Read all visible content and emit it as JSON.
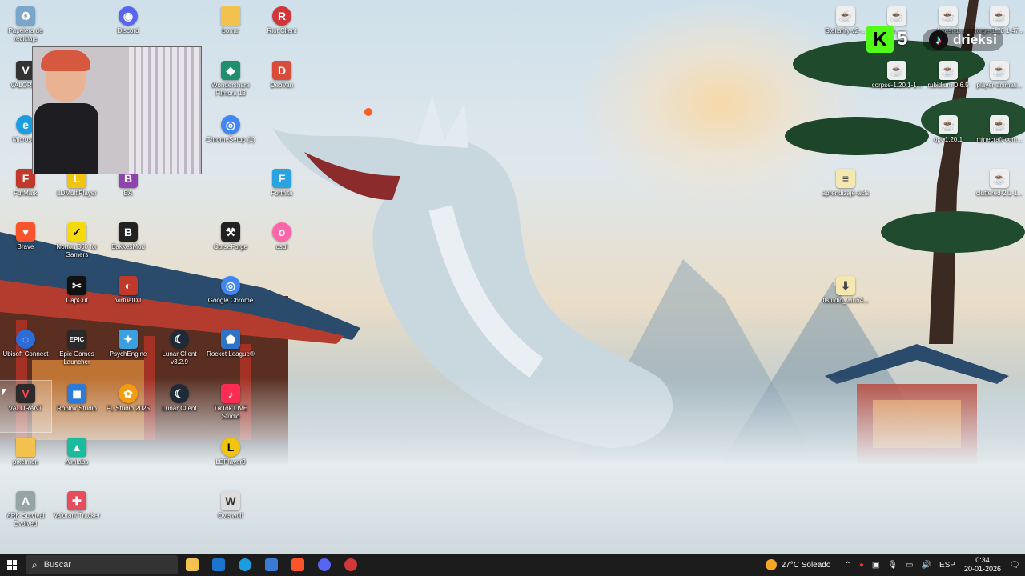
{
  "desktop_icons": [
    {
      "label": "Papelera de reciclaje",
      "icon": "recycle-bin-icon",
      "color": "#7aa6c9"
    },
    {
      "label": "Discord",
      "icon": "discord-icon",
      "color": "#5865f2"
    },
    {
      "label": "borrar",
      "icon": "folder-icon",
      "color": "#f2c14e"
    },
    {
      "label": "Riot Client",
      "icon": "riot-client-icon",
      "color": "#d13639"
    },
    {
      "label": "VALORAN",
      "icon": "valorant-icon",
      "color": "#333333"
    },
    {
      "label": "Wondershare Filmora 13",
      "icon": "filmora-icon",
      "color": "#1f8f6e"
    },
    {
      "label": "DeoVan",
      "icon": "deovan-icon",
      "color": "#d94b3a"
    },
    {
      "label": "Microsoft",
      "icon": "microsoft-edge-icon",
      "color": "#1b9de2"
    },
    {
      "label": "ChromeSetup (1)",
      "icon": "chrome-setup-icon",
      "color": "#4285f4"
    },
    {
      "label": "FurMark",
      "icon": "furmark-icon",
      "color": "#c0392b"
    },
    {
      "label": "LDMultiPlayer",
      "icon": "ldmultiplayer-icon",
      "color": "#f1c40f"
    },
    {
      "label": "BA",
      "icon": "ba-icon",
      "color": "#8e44ad"
    },
    {
      "label": "Fortnite",
      "icon": "fortnite-icon",
      "color": "#2aa3e0"
    },
    {
      "label": "Brave",
      "icon": "brave-icon",
      "color": "#fb542b"
    },
    {
      "label": "Norton 360 for Gamers",
      "icon": "norton-icon",
      "color": "#f5d90a"
    },
    {
      "label": "BakkesMod",
      "icon": "bakkesmod-icon",
      "color": "#222222"
    },
    {
      "label": "CurseForge",
      "icon": "curseforge-icon",
      "color": "#222222"
    },
    {
      "label": "osu!",
      "icon": "osu-icon",
      "color": "#ff66aa"
    },
    {
      "label": "CapCut",
      "icon": "capcut-icon",
      "color": "#111111"
    },
    {
      "label": "VirtualDJ",
      "icon": "virtualdj-icon",
      "color": "#c0392b"
    },
    {
      "label": "Google Chrome",
      "icon": "chrome-icon",
      "color": "#4285f4"
    },
    {
      "label": "Ubisoft Connect",
      "icon": "ubisoft-icon",
      "color": "#2b6cd6"
    },
    {
      "label": "Epic Games Launcher",
      "icon": "epic-games-icon",
      "color": "#2a2a2a"
    },
    {
      "label": "PsychEngine",
      "icon": "psychengine-icon",
      "color": "#3aa0e0"
    },
    {
      "label": "Lunar Client v3.2.9",
      "icon": "lunar-client-icon",
      "color": "#1e2a38"
    },
    {
      "label": "Rocket League®",
      "icon": "rocket-league-icon",
      "color": "#2d74c9"
    },
    {
      "label": "VALORANT",
      "icon": "valorant-icon",
      "color": "#2b2b2b"
    },
    {
      "label": "Roblox Studio",
      "icon": "roblox-studio-icon",
      "color": "#2d7bd6"
    },
    {
      "label": "FL Studio 2025",
      "icon": "fl-studio-icon",
      "color": "#f39c12"
    },
    {
      "label": "Lunar Client",
      "icon": "lunar-client-icon",
      "color": "#1e2a38"
    },
    {
      "label": "TikTok LIVE Studio",
      "icon": "tiktok-live-icon",
      "color": "#fe2c55"
    },
    {
      "label": "pixelmon",
      "icon": "folder-icon",
      "color": "#f2c14e"
    },
    {
      "label": "Aimlabs",
      "icon": "aimlabs-icon",
      "color": "#1abc9c"
    },
    {
      "label": "LDPlayer9",
      "icon": "ldplayer-icon",
      "color": "#f1c40f"
    },
    {
      "label": "ARK Survival Evolved",
      "icon": "ark-icon",
      "color": "#95a5a6"
    },
    {
      "label": "Valorant Tracker",
      "icon": "valorant-tracker-icon",
      "color": "#e74c5c"
    },
    {
      "label": "Overwolf",
      "icon": "overwolf-icon",
      "color": "#dddddd"
    },
    {
      "label": "Stellarity-v2-...",
      "icon": "java-file-icon",
      "color": "#eeeeee"
    },
    {
      "label": "r...",
      "icon": "java-file-icon",
      "color": "#eeeeee"
    },
    {
      "label": "...forest-1...",
      "icon": "java-file-icon",
      "color": "#eeeeee"
    },
    {
      "label": "forge-1.20.1-47...",
      "icon": "java-file-icon",
      "color": "#eeeeee"
    },
    {
      "label": "corpse-1.20.1-1...",
      "icon": "java-file-icon",
      "color": "#eeeeee"
    },
    {
      "label": "rubidium-0.6.5",
      "icon": "java-file-icon",
      "color": "#eeeeee"
    },
    {
      "label": "player-animati...",
      "icon": "java-file-icon",
      "color": "#eeeeee"
    },
    {
      "label": "opt-1.20.1",
      "icon": "java-file-icon",
      "color": "#eeeeee"
    },
    {
      "label": "minecraft-com...",
      "icon": "java-file-icon",
      "color": "#eeeeee"
    },
    {
      "label": "aprendizaje-acfs",
      "icon": "document-icon",
      "color": "#f4e7b0"
    },
    {
      "label": "cluttered-2.1-1...",
      "icon": "java-file-icon",
      "color": "#eeeeee"
    },
    {
      "label": "flstudio_win64...",
      "icon": "installer-icon",
      "color": "#f4e7b0"
    }
  ],
  "overlay": {
    "kick_letter": "K",
    "kick_count": "5",
    "tiktok_name": "drieksi"
  },
  "taskbar": {
    "search_placeholder": "Buscar",
    "apps": [
      {
        "name": "file-explorer-icon",
        "color": "#f2c14e"
      },
      {
        "name": "mail-icon",
        "color": "#1b74d0"
      },
      {
        "name": "edge-icon",
        "color": "#1b9de2"
      },
      {
        "name": "store-icon",
        "color": "#3a7bd5"
      },
      {
        "name": "brave-icon",
        "color": "#fb542b"
      },
      {
        "name": "discord-icon",
        "color": "#5865f2"
      },
      {
        "name": "riot-icon",
        "color": "#d13639"
      }
    ],
    "weather": "27°C Soleado",
    "language": "ESP",
    "time": "0:34",
    "date": "20-01-2026"
  }
}
